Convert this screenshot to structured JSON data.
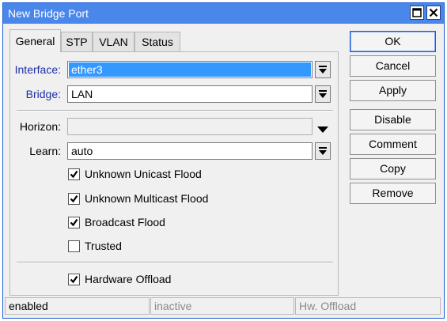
{
  "window": {
    "title": "New Bridge Port"
  },
  "tabs": [
    {
      "label": "General",
      "active": true
    },
    {
      "label": "STP",
      "active": false
    },
    {
      "label": "VLAN",
      "active": false
    },
    {
      "label": "Status",
      "active": false
    }
  ],
  "form": {
    "interface": {
      "label": "Interface:",
      "value": "ether3"
    },
    "bridge": {
      "label": "Bridge:",
      "value": "LAN"
    },
    "horizon": {
      "label": "Horizon:",
      "value": ""
    },
    "learn": {
      "label": "Learn:",
      "value": "auto"
    }
  },
  "checkboxes": {
    "unknown_unicast_flood": {
      "label": "Unknown Unicast Flood",
      "checked": true
    },
    "unknown_multicast_flood": {
      "label": "Unknown Multicast Flood",
      "checked": true
    },
    "broadcast_flood": {
      "label": "Broadcast Flood",
      "checked": true
    },
    "trusted": {
      "label": "Trusted",
      "checked": false
    },
    "hardware_offload": {
      "label": "Hardware Offload",
      "checked": true
    }
  },
  "buttons": {
    "ok": "OK",
    "cancel": "Cancel",
    "apply": "Apply",
    "disable": "Disable",
    "comment": "Comment",
    "copy": "Copy",
    "remove": "Remove"
  },
  "statusbar": {
    "state": "enabled",
    "activity": "inactive",
    "offload": "Hw. Offload"
  },
  "colors": {
    "titlebar": "#4a87ea",
    "label_accent": "#1f2fa8",
    "selection": "#3399ff"
  }
}
